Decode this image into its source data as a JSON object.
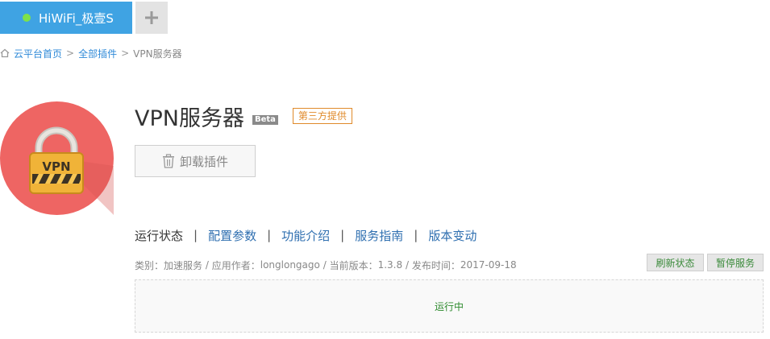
{
  "device_tabs": {
    "active_label": "HiWiFi_极壹S",
    "status_color": "#7ee24a",
    "add_label": "+"
  },
  "breadcrumb": {
    "items": [
      "云平台首页",
      "全部插件",
      "VPN服务器"
    ],
    "separator": ">"
  },
  "plugin": {
    "name": "VPN服务器",
    "beta_badge": "Beta",
    "third_party_badge": "第三方提供",
    "logo_text": "VPN",
    "uninstall_label": "卸载插件"
  },
  "tabs": [
    {
      "label": "运行状态",
      "active": true
    },
    {
      "label": "配置参数",
      "active": false
    },
    {
      "label": "功能介绍",
      "active": false
    },
    {
      "label": "服务指南",
      "active": false
    },
    {
      "label": "版本变动",
      "active": false
    }
  ],
  "tab_separator": "|",
  "meta": {
    "category_label": "类别：",
    "category": "加速服务",
    "author_label": "应用作者：",
    "author": "longlongago",
    "version_label": "当前版本：",
    "version": "1.3.8",
    "date_label": "发布时间：",
    "date": "2017-09-18",
    "divider": "/"
  },
  "actions": {
    "refresh_label": "刷新状态",
    "pause_label": "暂停服务"
  },
  "status": {
    "text": "运行中"
  },
  "colors": {
    "accent": "#3fa3e3",
    "link": "#2f8ad8",
    "badge_orange": "#e08a2a",
    "status_green": "#2e8b2e"
  },
  "icons": [
    "home-icon",
    "plus-icon",
    "vpn-lock-icon",
    "trash-icon"
  ]
}
